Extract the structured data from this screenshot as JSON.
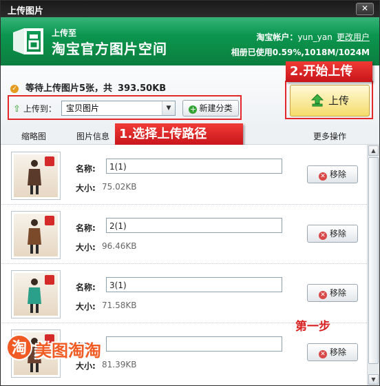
{
  "window": {
    "title": "上传图片",
    "close_glyph": "✕"
  },
  "header": {
    "brand_small": "上传至",
    "brand_big": "淘宝官方图片空间",
    "account_label": "淘宝帐户：",
    "account_user": "yun_yan",
    "switch_user": "更改用户",
    "usage_label": "相册已使用",
    "usage_value": "0.59%,1018M/1024M"
  },
  "queue": {
    "status_text": "等待上传图片5张，共",
    "total_size": "393.50KB"
  },
  "destination": {
    "label": "上传到：",
    "selected": "宝贝图片",
    "new_category_button": "新建分类"
  },
  "upload_button": "上传",
  "tabs": [
    "缩略图",
    "图片信息",
    "更多操作"
  ],
  "field_labels": {
    "name": "名称:",
    "size": "大小:"
  },
  "remove_label": "移除",
  "files": [
    {
      "name": "1(1)",
      "size": "75.02KB",
      "tone": "#5a3a2a"
    },
    {
      "name": "2(1)",
      "size": "96.46KB",
      "tone": "#7a4a2a"
    },
    {
      "name": "3(1)",
      "size": "71.58KB",
      "tone": "#2aa08a"
    },
    {
      "name": "",
      "size": "81.39KB",
      "tone": "#6a4030"
    }
  ],
  "annotations": {
    "step1": "1.选择上传路径",
    "step2": "2.开始上传",
    "first_step": "第一步"
  },
  "watermark": {
    "glyph": "淘",
    "text": "美图淘淘"
  },
  "colors": {
    "accent_green": "#0b8a45",
    "callout_red": "#e2282a",
    "upload_yellow": "#f5dc6b"
  }
}
